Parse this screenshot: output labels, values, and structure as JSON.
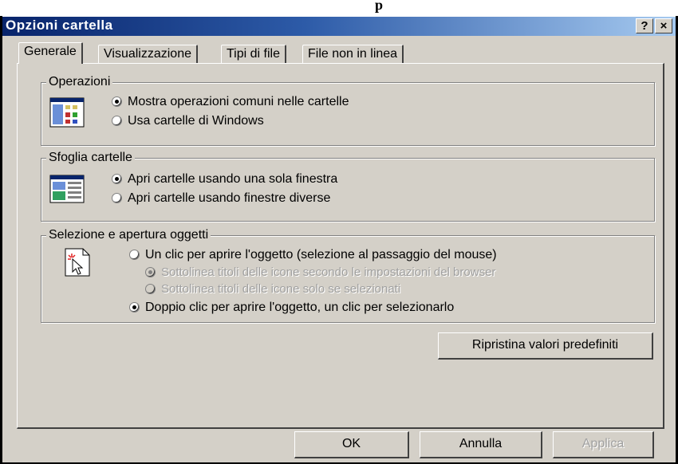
{
  "window": {
    "top_fragment": "p",
    "title": "Opzioni cartella",
    "help_label": "?",
    "close_label": "×"
  },
  "tabs": [
    {
      "label": "Generale",
      "active": true
    },
    {
      "label": "Visualizzazione",
      "active": false
    },
    {
      "label": "Tipi di file",
      "active": false
    },
    {
      "label": "File non in linea",
      "active": false
    }
  ],
  "groups": {
    "operazioni": {
      "title": "Operazioni",
      "options": [
        {
          "label": "Mostra operazioni comuni nelle cartelle",
          "checked": true
        },
        {
          "label": "Usa cartelle di Windows",
          "checked": false
        }
      ]
    },
    "sfoglia": {
      "title": "Sfoglia cartelle",
      "options": [
        {
          "label": "Apri cartelle usando una sola finestra",
          "checked": true
        },
        {
          "label": "Apri cartelle usando finestre diverse",
          "checked": false
        }
      ]
    },
    "selezione": {
      "title": "Selezione e apertura oggetti",
      "options": [
        {
          "label": "Un clic per aprire l'oggetto (selezione al passaggio del mouse)",
          "checked": false
        },
        {
          "label": "Sottolinea titoli delle icone secondo le impostazioni del browser",
          "checked": true,
          "disabled": true
        },
        {
          "label": "Sottolinea titoli delle icone solo se selezionati",
          "checked": false,
          "disabled": true
        },
        {
          "label": "Doppio clic per aprire l'oggetto, un clic per selezionarlo",
          "checked": true
        }
      ]
    }
  },
  "buttons": {
    "restore": "Ripristina valori predefiniti",
    "ok": "OK",
    "cancel": "Annulla",
    "apply": "Applica"
  },
  "colors": {
    "face": "#d4d0c8",
    "title_start": "#08246b",
    "title_end": "#a6caf0"
  },
  "icons": [
    "folder-tasks-icon",
    "folder-browse-icon",
    "click-cursor-icon"
  ]
}
